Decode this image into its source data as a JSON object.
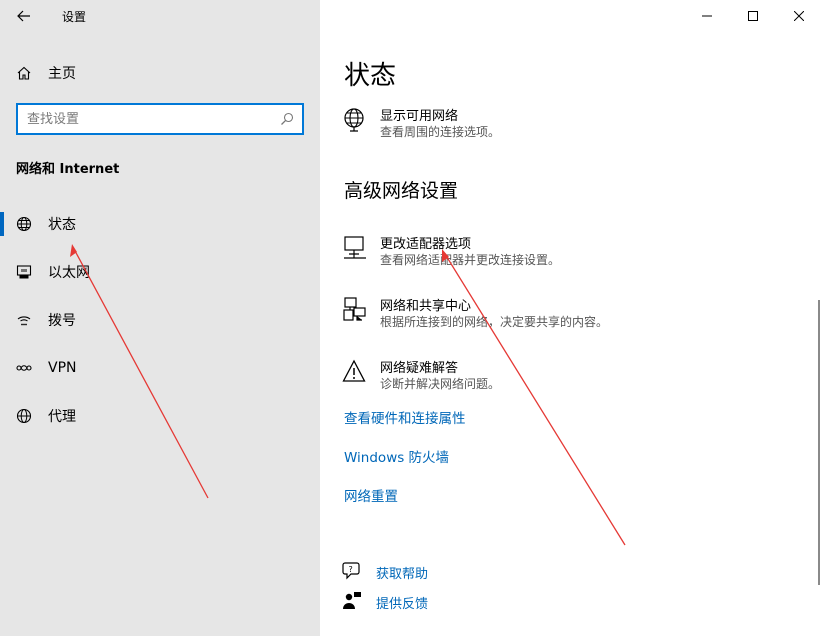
{
  "app": {
    "title": "设置"
  },
  "sidebar": {
    "home_label": "主页",
    "search_placeholder": "查找设置",
    "section_heading": "网络和 Internet",
    "items": [
      {
        "label": "状态",
        "icon": "globe-icon",
        "selected": true
      },
      {
        "label": "以太网",
        "icon": "ethernet-icon",
        "selected": false
      },
      {
        "label": "拨号",
        "icon": "dialup-icon",
        "selected": false
      },
      {
        "label": "VPN",
        "icon": "vpn-icon",
        "selected": false
      },
      {
        "label": "代理",
        "icon": "globe-icon",
        "selected": false
      }
    ]
  },
  "main": {
    "page_title": "状态",
    "show_networks": {
      "title": "显示可用网络",
      "desc": "查看周围的连接选项。"
    },
    "advanced_heading": "高级网络设置",
    "settings": [
      {
        "title": "更改适配器选项",
        "desc": "查看网络适配器并更改连接设置。",
        "icon": "monitor-network-icon"
      },
      {
        "title": "网络和共享中心",
        "desc": "根据所连接到的网络，决定要共享的内容。",
        "icon": "sharing-center-icon"
      },
      {
        "title": "网络疑难解答",
        "desc": "诊断并解决网络问题。",
        "icon": "warning-icon"
      }
    ],
    "links": [
      "查看硬件和连接属性",
      "Windows 防火墙",
      "网络重置"
    ],
    "help": {
      "get_help": "获取帮助",
      "feedback": "提供反馈"
    }
  },
  "colors": {
    "sidebar_bg": "#e6e6e6",
    "accent": "#0067c0",
    "link": "#0067b8",
    "annotation": "#e53935"
  }
}
